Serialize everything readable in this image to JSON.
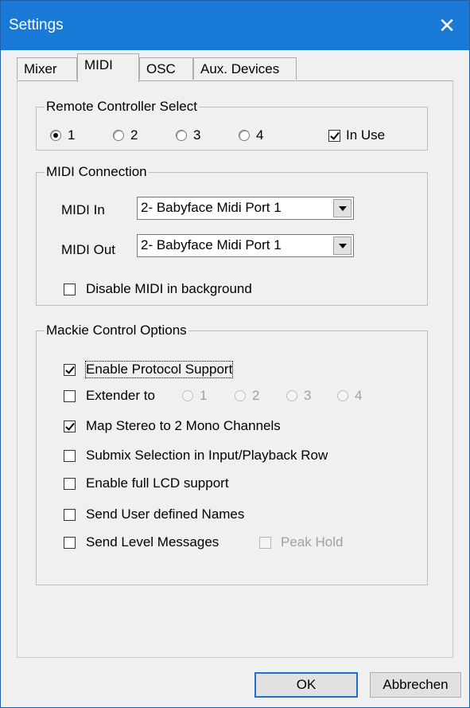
{
  "window": {
    "title": "Settings"
  },
  "tabs": [
    {
      "label": "Mixer"
    },
    {
      "label": "MIDI"
    },
    {
      "label": "OSC"
    },
    {
      "label": "Aux. Devices"
    }
  ],
  "remote": {
    "legend": "Remote Controller Select",
    "options": [
      "1",
      "2",
      "3",
      "4"
    ],
    "selected": "1",
    "in_use_label": "In Use",
    "in_use_checked": true
  },
  "midi": {
    "legend": "MIDI Connection",
    "in_label": "MIDI In",
    "in_value": "2- Babyface Midi Port 1",
    "out_label": "MIDI Out",
    "out_value": "2- Babyface Midi Port 1",
    "disable_bg_label": "Disable MIDI in background"
  },
  "mackie": {
    "legend": "Mackie Control Options",
    "enable_protocol": "Enable Protocol Support",
    "extender": "Extender to",
    "extender_options": [
      "1",
      "2",
      "3",
      "4"
    ],
    "map_stereo": "Map Stereo to 2 Mono Channels",
    "submix": "Submix Selection in Input/Playback Row",
    "full_lcd": "Enable full LCD support",
    "user_names": "Send User defined Names",
    "level_messages": "Send Level Messages",
    "peak_hold": "Peak Hold"
  },
  "buttons": {
    "ok": "OK",
    "cancel": "Abbrechen"
  }
}
